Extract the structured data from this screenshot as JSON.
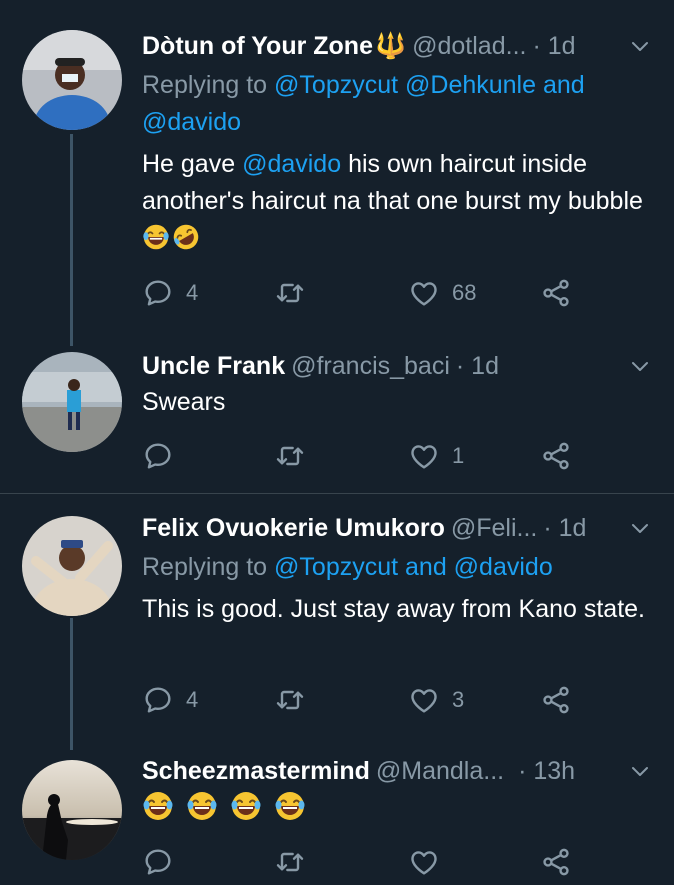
{
  "tweets": [
    {
      "name": "Dòtun of Your Zone",
      "name_emoji": "🔱",
      "handle": "@dotlad...",
      "time": "· 1d",
      "reply_prefix": "Replying to ",
      "reply_mentions": "@Topzycut @Dehkunle and",
      "reply_mentions_2": "@davido",
      "body_1": "He gave ",
      "body_mention": "@davido",
      "body_2": "  his own haircut inside another's haircut na that one burst my bubble",
      "body_emojis": [
        "laughing-tears",
        "rofl"
      ],
      "replies": "4",
      "retweets": "",
      "likes": "68"
    },
    {
      "name": "Uncle Frank",
      "handle": "@francis_baci",
      "time": "· 1d",
      "body": "Swears",
      "replies": "",
      "retweets": "",
      "likes": "1"
    },
    {
      "name": "Felix Ovuokerie Umukoro",
      "handle": "@Feli...",
      "time": "· 1d",
      "reply_prefix": "Replying to ",
      "reply_mentions": "@Topzycut and @davido",
      "body": "This is good. Just stay away from Kano state.",
      "replies": "4",
      "retweets": "",
      "likes": "3"
    },
    {
      "name": "Scheezmastermind",
      "handle": "@Mandla...",
      "time": "· 13h",
      "body_emojis": [
        "laughing-tears",
        "laughing-tears",
        "laughing-tears",
        "laughing-tears"
      ],
      "replies": "",
      "retweets": "",
      "likes": ""
    }
  ],
  "colors": {
    "background": "#15202b",
    "secondary_text": "#8899a6",
    "mention": "#1da1f2",
    "divider": "#38444d"
  }
}
